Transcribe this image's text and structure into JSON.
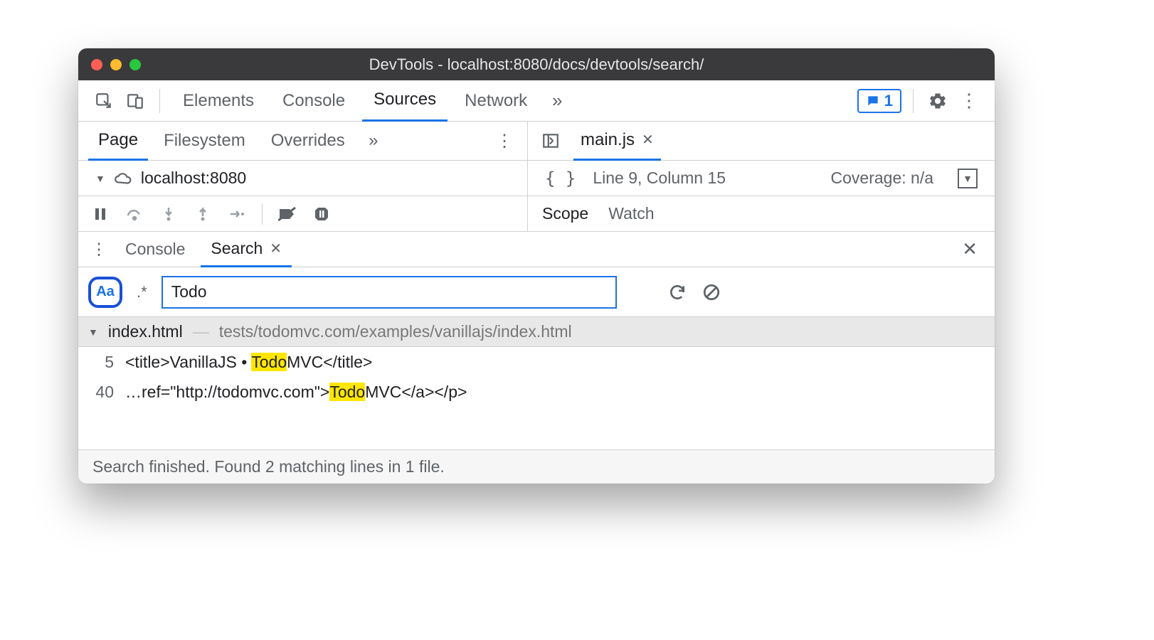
{
  "window": {
    "title": "DevTools - localhost:8080/docs/devtools/search/"
  },
  "mainTabs": {
    "elements": "Elements",
    "console": "Console",
    "sources": "Sources",
    "network": "Network",
    "feedbackCount": "1"
  },
  "sourcesNav": {
    "page": "Page",
    "filesystem": "Filesystem",
    "overrides": "Overrides"
  },
  "editor": {
    "openFile": "main.js",
    "cursorStatus": "Line 9, Column 15",
    "coverage": "Coverage: n/a"
  },
  "tree": {
    "host": "localhost:8080"
  },
  "sidebarTabs": {
    "scope": "Scope",
    "watch": "Watch"
  },
  "drawer": {
    "console": "Console",
    "search": "Search"
  },
  "search": {
    "caseLabel": "Aa",
    "regexLabel": ".*",
    "query": "Todo"
  },
  "results": {
    "file": "index.html",
    "path": "tests/todomvc.com/examples/vanillajs/index.html",
    "lines": [
      {
        "n": "5",
        "pre": "<title>VanillaJS • ",
        "match": "Todo",
        "post": "MVC</title>"
      },
      {
        "n": "40",
        "pre": "…ref=\"http://todomvc.com\">",
        "match": "Todo",
        "post": "MVC</a></p>"
      }
    ]
  },
  "status": "Search finished.  Found 2 matching lines in 1 file."
}
